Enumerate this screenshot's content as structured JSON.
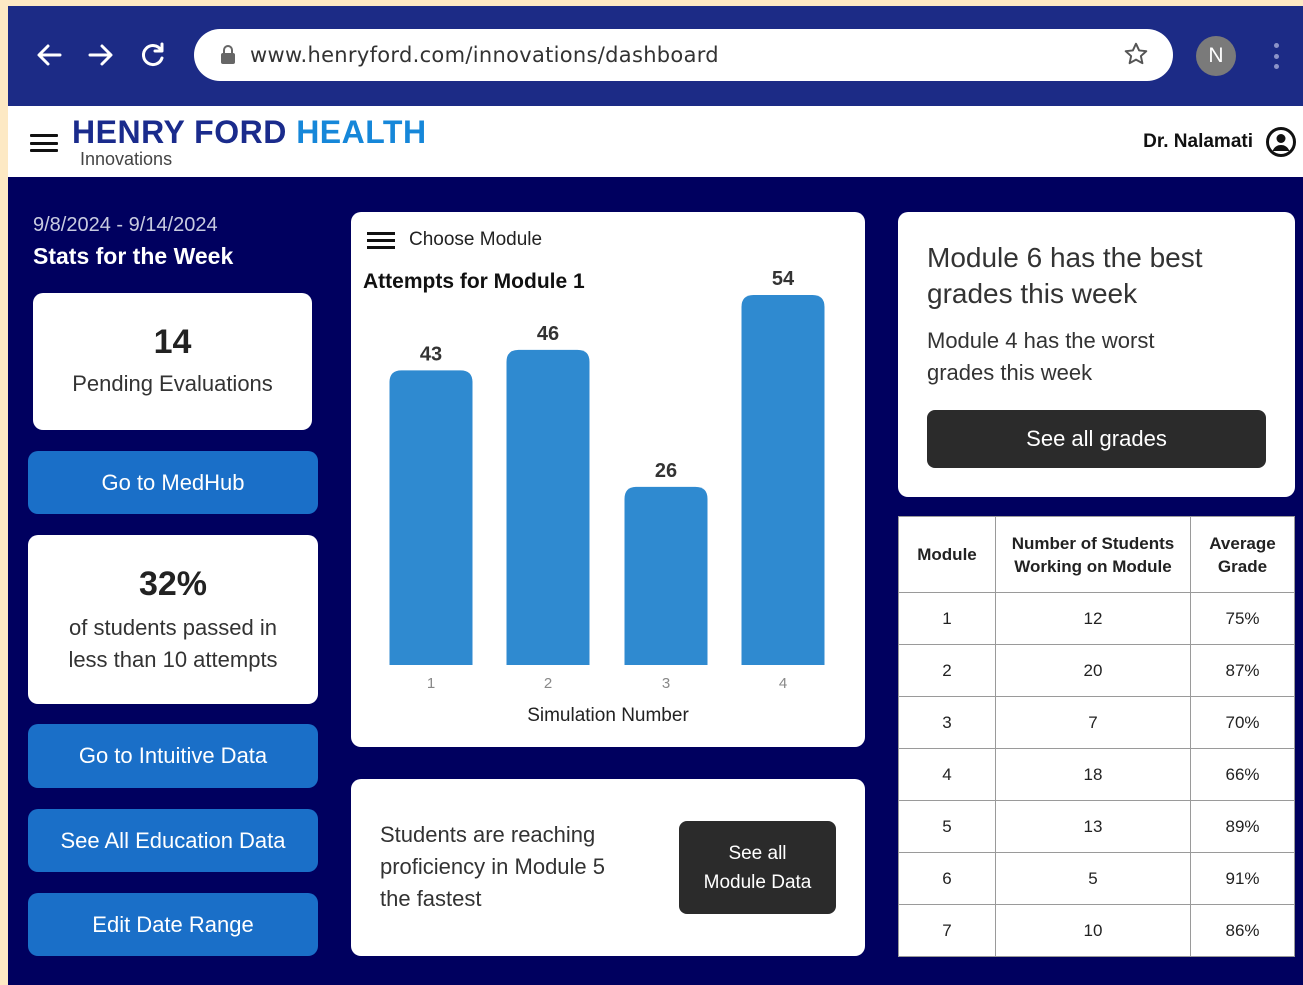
{
  "browser": {
    "url": "www.henryford.com/innovations/dashboard",
    "profile_initial": "N"
  },
  "header": {
    "brand_part1": "HENRY FORD",
    "brand_part2": "HEALTH",
    "brand_sub": "Innovations",
    "user_name": "Dr. Nalamati"
  },
  "left": {
    "date_range": "9/8/2024 - 9/14/2024",
    "title": "Stats for the Week",
    "pending_count": "14",
    "pending_label": "Pending Evaluations",
    "pass_pct": "32%",
    "pass_label_1": "of students passed in",
    "pass_label_2": "less than 10 attempts",
    "btn_medhub": "Go to MedHub",
    "btn_intuitive": "Go to Intuitive Data",
    "btn_education": "See All Education Data",
    "btn_date": "Edit Date Range"
  },
  "chart_menu_label": "Choose Module",
  "chart_data": {
    "type": "bar",
    "title": "Attempts for Module 1",
    "xlabel": "Simulation Number",
    "ylabel": "",
    "categories": [
      "1",
      "2",
      "3",
      "4"
    ],
    "values": [
      43,
      46,
      26,
      54
    ],
    "ylim": [
      0,
      54
    ],
    "color": "#2f8ad0"
  },
  "proficiency": {
    "line1": "Students are reaching",
    "line2": "proficiency in Module 5",
    "line3": "the fastest",
    "btn_line1": "See all",
    "btn_line2": "Module Data"
  },
  "grades": {
    "best_line1": "Module 6 has the best",
    "best_line2": "grades this week",
    "worst_line1": "Module 4 has the worst",
    "worst_line2": "grades this week",
    "btn": "See all grades"
  },
  "table": {
    "headers": [
      "Module",
      "Number of Students Working on Module",
      "Average Grade"
    ],
    "rows": [
      [
        "1",
        "12",
        "75%"
      ],
      [
        "2",
        "20",
        "87%"
      ],
      [
        "3",
        "7",
        "70%"
      ],
      [
        "4",
        "18",
        "66%"
      ],
      [
        "5",
        "13",
        "89%"
      ],
      [
        "6",
        "5",
        "91%"
      ],
      [
        "7",
        "10",
        "86%"
      ]
    ]
  }
}
